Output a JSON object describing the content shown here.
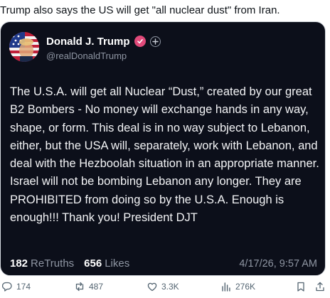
{
  "caption": "Trump also says the US will get \"all nuclear dust\" from Iran.",
  "post": {
    "author_name": "Donald J. Trump",
    "handle": "@realDonaldTrump",
    "text": "The U.S.A. will get all Nuclear “Dust,” created by our great B2 Bombers - No money will exchange hands in any way, shape, or form. This deal is in no way subject to Lebanon, either, but the USA will, separately, work with Lebanon, and deal with the Hezboolah situation in an appropriate manner. Israel will not be bombing Lebanon any longer. They are PROHIBITED from doing so by the U.S.A. Enough is enough!!! Thank you! President DJT",
    "retruths_count": "182",
    "retruths_label": "ReTruths",
    "likes_count": "656",
    "likes_label": "Likes",
    "timestamp": "4/17/26, 9:57 AM",
    "colors": {
      "card_bg": "#0c0f1a",
      "verified_badge": "#e14a7a",
      "muted": "#8f96a3"
    }
  },
  "actions": {
    "replies": "174",
    "reposts": "487",
    "likes": "3.3K",
    "views": "276K"
  },
  "icons": [
    "avatar-flag",
    "verified-badge-icon",
    "plus-icon",
    "reply-icon",
    "repost-icon",
    "like-icon",
    "views-icon",
    "bookmark-icon",
    "share-icon"
  ]
}
